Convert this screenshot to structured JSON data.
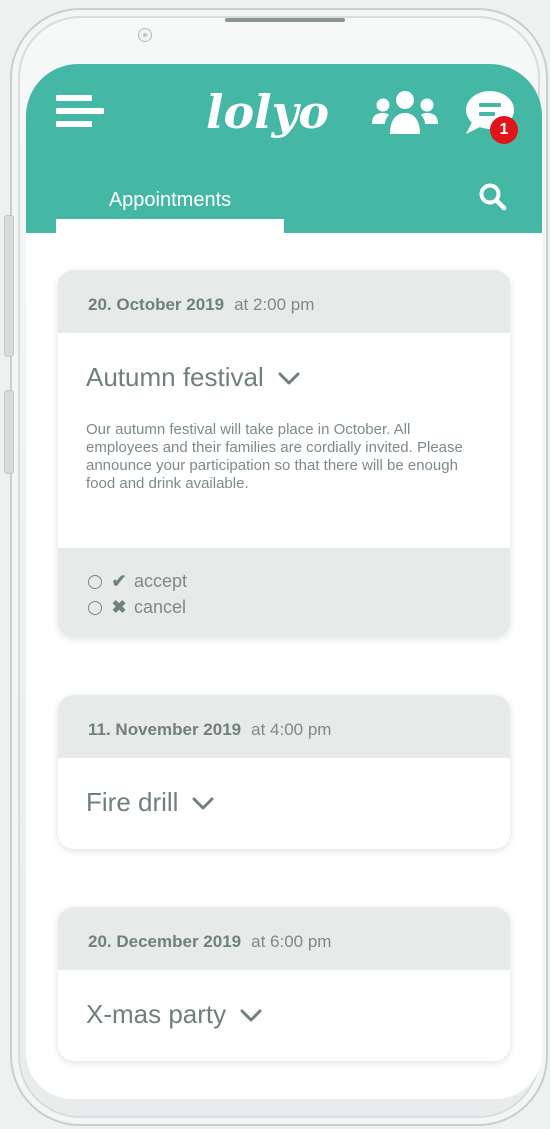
{
  "app": {
    "logo_text": "lolyo",
    "notification_count": "1",
    "accent_color": "#45b8a5",
    "badge_color": "#e0151b"
  },
  "header": {
    "tab_label": "Appointments",
    "icons": [
      "menu-icon",
      "group-icon",
      "chat-icon",
      "search-icon"
    ]
  },
  "appointments": [
    {
      "date": "20. October 2019",
      "time": "at 2:00 pm",
      "title": "Autumn festival",
      "description": "Our autumn festival will take place in October. All employees and their families are cordially invited. Please announce your participation so that there will be enough food and drink available.",
      "options": [
        {
          "icon": "check-icon",
          "mark": "✔",
          "label": "accept"
        },
        {
          "icon": "cross-icon",
          "mark": "✖",
          "label": "cancel"
        }
      ]
    },
    {
      "date": "11. November 2019",
      "time": "at 4:00 pm",
      "title": "Fire drill"
    },
    {
      "date": "20. December 2019",
      "time": "at 6:00 pm",
      "title": "X-mas party"
    }
  ]
}
